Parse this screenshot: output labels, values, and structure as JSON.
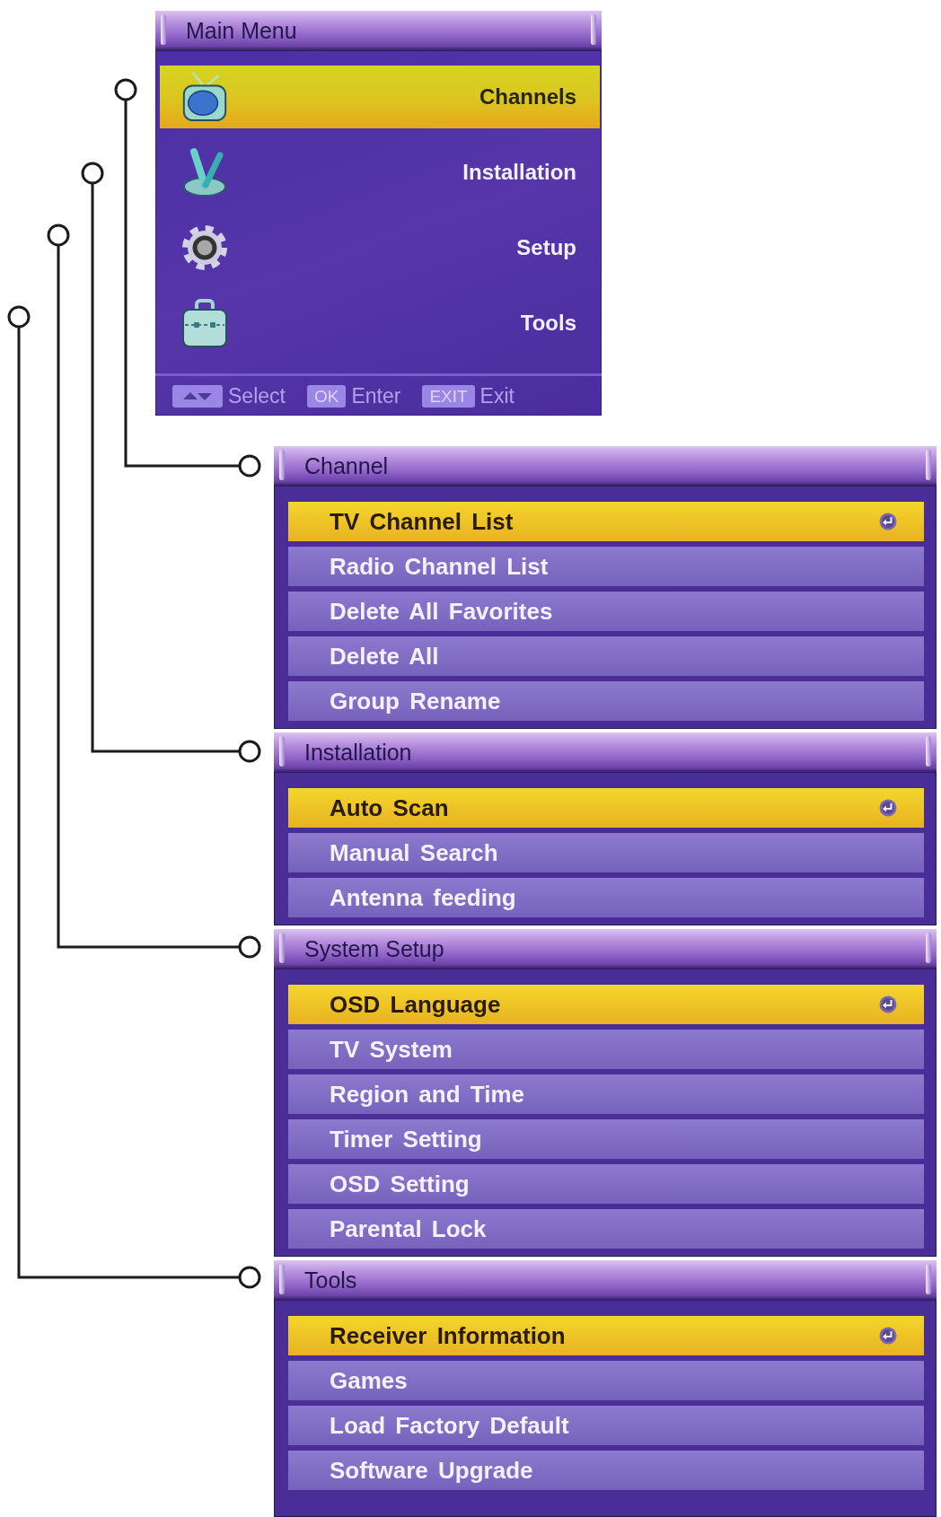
{
  "main_menu": {
    "title": "Main Menu",
    "items": [
      {
        "label": "Channels",
        "selected": true
      },
      {
        "label": "Installation",
        "selected": false
      },
      {
        "label": "Setup",
        "selected": false
      },
      {
        "label": "Tools",
        "selected": false
      }
    ],
    "footer": [
      {
        "kind": "arrows",
        "label": "Select"
      },
      {
        "kind": "key",
        "key": "OK",
        "label": "Enter"
      },
      {
        "kind": "key",
        "key": "EXIT",
        "label": "Exit"
      }
    ]
  },
  "submenus": [
    {
      "title": "Channel",
      "items": [
        {
          "label": "TV Channel List",
          "selected": true
        },
        {
          "label": "Radio Channel List",
          "selected": false
        },
        {
          "label": "Delete All Favorites",
          "selected": false
        },
        {
          "label": "Delete All",
          "selected": false
        },
        {
          "label": "Group Rename",
          "selected": false
        }
      ]
    },
    {
      "title": "Installation",
      "items": [
        {
          "label": "Auto Scan",
          "selected": true
        },
        {
          "label": "Manual Search",
          "selected": false
        },
        {
          "label": "Antenna feeding",
          "selected": false
        }
      ]
    },
    {
      "title": "System Setup",
      "items": [
        {
          "label": "OSD Language",
          "selected": true
        },
        {
          "label": "TV System",
          "selected": false
        },
        {
          "label": "Region and Time",
          "selected": false
        },
        {
          "label": "Timer Setting",
          "selected": false
        },
        {
          "label": "OSD Setting",
          "selected": false
        },
        {
          "label": "Parental Lock",
          "selected": false
        }
      ]
    },
    {
      "title": "Tools",
      "items": [
        {
          "label": "Receiver Information",
          "selected": true
        },
        {
          "label": "Games",
          "selected": false
        },
        {
          "label": "Load Factory Default",
          "selected": false
        },
        {
          "label": "Software Upgrade",
          "selected": false
        }
      ]
    }
  ]
}
